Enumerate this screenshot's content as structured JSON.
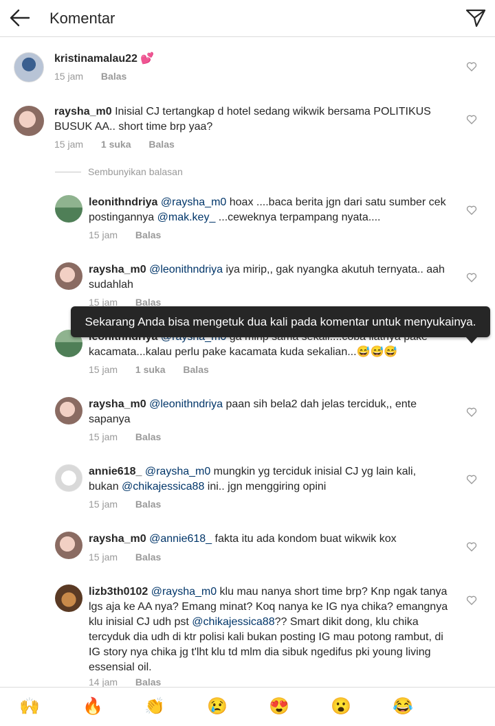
{
  "header": {
    "title": "Komentar"
  },
  "hide_replies": "Sembunyikan balasan",
  "tooltip": "Sekarang Anda bisa mengetuk dua kali pada komentar untuk menyukainya.",
  "comments": [
    {
      "username": "kristinamalau22",
      "text": "💕",
      "time": "15 jam",
      "likes": "",
      "reply": "Balas"
    },
    {
      "username": "raysha_m0",
      "text": "Inisial CJ tertangkap d hotel sedang wikwik bersama POLITIKUS BUSUK AA.. short time brp yaa?",
      "time": "15 jam",
      "likes": "1 suka",
      "reply": "Balas"
    },
    {
      "username": "leonithndriya",
      "mention1": "@raysha_m0",
      "text1": " hoax ....baca berita jgn dari satu sumber cek postingannya ",
      "mention2": "@mak.key_",
      "text2": " ...ceweknya terpampang nyata....",
      "time": "15 jam",
      "reply": "Balas"
    },
    {
      "username": "raysha_m0",
      "mention1": "@leonithndriya",
      "text1": " iya mirip,, gak nyangka akutuh ternyata.. aah sudahlah",
      "time": "15 jam",
      "reply": "Balas"
    },
    {
      "username": "leonithndriya",
      "mention1": "@raysha_m0",
      "text1": " ga mirip sama sekali....coba liatnya pake kacamata...kalau perlu pake kacamata kuda sekalian...😅😅😅",
      "time": "15 jam",
      "likes": "1 suka",
      "reply": "Balas"
    },
    {
      "username": "raysha_m0",
      "mention1": "@leonithndriya",
      "text1": " paan sih bela2 dah jelas terciduk,, ente sapanya",
      "time": "15 jam",
      "reply": "Balas"
    },
    {
      "username": "annie618_",
      "mention1": "@raysha_m0",
      "text1": " mungkin yg terciduk inisial CJ yg lain kali, bukan ",
      "mention2": "@chikajessica88",
      "text2": " ini.. jgn menggiring opini",
      "time": "15 jam",
      "reply": "Balas"
    },
    {
      "username": "raysha_m0",
      "mention1": "@annie618_",
      "text1": " fakta itu ada kondom buat wikwik kox",
      "time": "15 jam",
      "reply": "Balas"
    },
    {
      "username": "lizb3th0102",
      "mention1": "@raysha_m0",
      "text1": " klu mau nanya short time brp? Knp ngak tanya lgs aja ke AA nya? Emang minat? Koq nanya ke IG nya chika? emangnya klu inisial CJ udh pst ",
      "mention2": "@chikajessica88",
      "text2": "?? Smart dikit dong, klu chika tercyduk dia udh di ktr polisi kali bukan  posting IG mau potong rambut, di IG story nya chika jg t'lht klu td mlm dia sibuk ngedifus pki young living essensial oil.",
      "time": "14 jam",
      "reply": "Balas"
    }
  ],
  "emoji_bar": [
    "🙌",
    "🔥",
    "👏",
    "😢",
    "😍",
    "😮",
    "😂"
  ],
  "icons": {
    "back": "arrow-left-icon",
    "send": "paper-plane-icon",
    "like": "heart-outline-icon"
  }
}
